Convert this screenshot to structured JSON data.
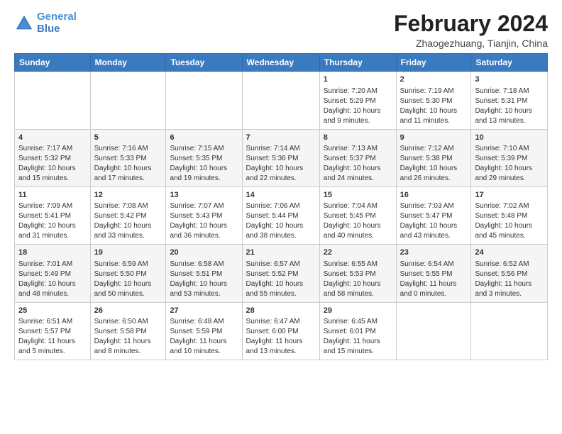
{
  "logo": {
    "line1": "General",
    "line2": "Blue"
  },
  "title": "February 2024",
  "subtitle": "Zhaogezhuang, Tianjin, China",
  "weekdays": [
    "Sunday",
    "Monday",
    "Tuesday",
    "Wednesday",
    "Thursday",
    "Friday",
    "Saturday"
  ],
  "weeks": [
    [
      {
        "day": "",
        "content": ""
      },
      {
        "day": "",
        "content": ""
      },
      {
        "day": "",
        "content": ""
      },
      {
        "day": "",
        "content": ""
      },
      {
        "day": "1",
        "content": "Sunrise: 7:20 AM\nSunset: 5:29 PM\nDaylight: 10 hours\nand 9 minutes."
      },
      {
        "day": "2",
        "content": "Sunrise: 7:19 AM\nSunset: 5:30 PM\nDaylight: 10 hours\nand 11 minutes."
      },
      {
        "day": "3",
        "content": "Sunrise: 7:18 AM\nSunset: 5:31 PM\nDaylight: 10 hours\nand 13 minutes."
      }
    ],
    [
      {
        "day": "4",
        "content": "Sunrise: 7:17 AM\nSunset: 5:32 PM\nDaylight: 10 hours\nand 15 minutes."
      },
      {
        "day": "5",
        "content": "Sunrise: 7:16 AM\nSunset: 5:33 PM\nDaylight: 10 hours\nand 17 minutes."
      },
      {
        "day": "6",
        "content": "Sunrise: 7:15 AM\nSunset: 5:35 PM\nDaylight: 10 hours\nand 19 minutes."
      },
      {
        "day": "7",
        "content": "Sunrise: 7:14 AM\nSunset: 5:36 PM\nDaylight: 10 hours\nand 22 minutes."
      },
      {
        "day": "8",
        "content": "Sunrise: 7:13 AM\nSunset: 5:37 PM\nDaylight: 10 hours\nand 24 minutes."
      },
      {
        "day": "9",
        "content": "Sunrise: 7:12 AM\nSunset: 5:38 PM\nDaylight: 10 hours\nand 26 minutes."
      },
      {
        "day": "10",
        "content": "Sunrise: 7:10 AM\nSunset: 5:39 PM\nDaylight: 10 hours\nand 29 minutes."
      }
    ],
    [
      {
        "day": "11",
        "content": "Sunrise: 7:09 AM\nSunset: 5:41 PM\nDaylight: 10 hours\nand 31 minutes."
      },
      {
        "day": "12",
        "content": "Sunrise: 7:08 AM\nSunset: 5:42 PM\nDaylight: 10 hours\nand 33 minutes."
      },
      {
        "day": "13",
        "content": "Sunrise: 7:07 AM\nSunset: 5:43 PM\nDaylight: 10 hours\nand 36 minutes."
      },
      {
        "day": "14",
        "content": "Sunrise: 7:06 AM\nSunset: 5:44 PM\nDaylight: 10 hours\nand 38 minutes."
      },
      {
        "day": "15",
        "content": "Sunrise: 7:04 AM\nSunset: 5:45 PM\nDaylight: 10 hours\nand 40 minutes."
      },
      {
        "day": "16",
        "content": "Sunrise: 7:03 AM\nSunset: 5:47 PM\nDaylight: 10 hours\nand 43 minutes."
      },
      {
        "day": "17",
        "content": "Sunrise: 7:02 AM\nSunset: 5:48 PM\nDaylight: 10 hours\nand 45 minutes."
      }
    ],
    [
      {
        "day": "18",
        "content": "Sunrise: 7:01 AM\nSunset: 5:49 PM\nDaylight: 10 hours\nand 48 minutes."
      },
      {
        "day": "19",
        "content": "Sunrise: 6:59 AM\nSunset: 5:50 PM\nDaylight: 10 hours\nand 50 minutes."
      },
      {
        "day": "20",
        "content": "Sunrise: 6:58 AM\nSunset: 5:51 PM\nDaylight: 10 hours\nand 53 minutes."
      },
      {
        "day": "21",
        "content": "Sunrise: 6:57 AM\nSunset: 5:52 PM\nDaylight: 10 hours\nand 55 minutes."
      },
      {
        "day": "22",
        "content": "Sunrise: 6:55 AM\nSunset: 5:53 PM\nDaylight: 10 hours\nand 58 minutes."
      },
      {
        "day": "23",
        "content": "Sunrise: 6:54 AM\nSunset: 5:55 PM\nDaylight: 11 hours\nand 0 minutes."
      },
      {
        "day": "24",
        "content": "Sunrise: 6:52 AM\nSunset: 5:56 PM\nDaylight: 11 hours\nand 3 minutes."
      }
    ],
    [
      {
        "day": "25",
        "content": "Sunrise: 6:51 AM\nSunset: 5:57 PM\nDaylight: 11 hours\nand 5 minutes."
      },
      {
        "day": "26",
        "content": "Sunrise: 6:50 AM\nSunset: 5:58 PM\nDaylight: 11 hours\nand 8 minutes."
      },
      {
        "day": "27",
        "content": "Sunrise: 6:48 AM\nSunset: 5:59 PM\nDaylight: 11 hours\nand 10 minutes."
      },
      {
        "day": "28",
        "content": "Sunrise: 6:47 AM\nSunset: 6:00 PM\nDaylight: 11 hours\nand 13 minutes."
      },
      {
        "day": "29",
        "content": "Sunrise: 6:45 AM\nSunset: 6:01 PM\nDaylight: 11 hours\nand 15 minutes."
      },
      {
        "day": "",
        "content": ""
      },
      {
        "day": "",
        "content": ""
      }
    ]
  ]
}
